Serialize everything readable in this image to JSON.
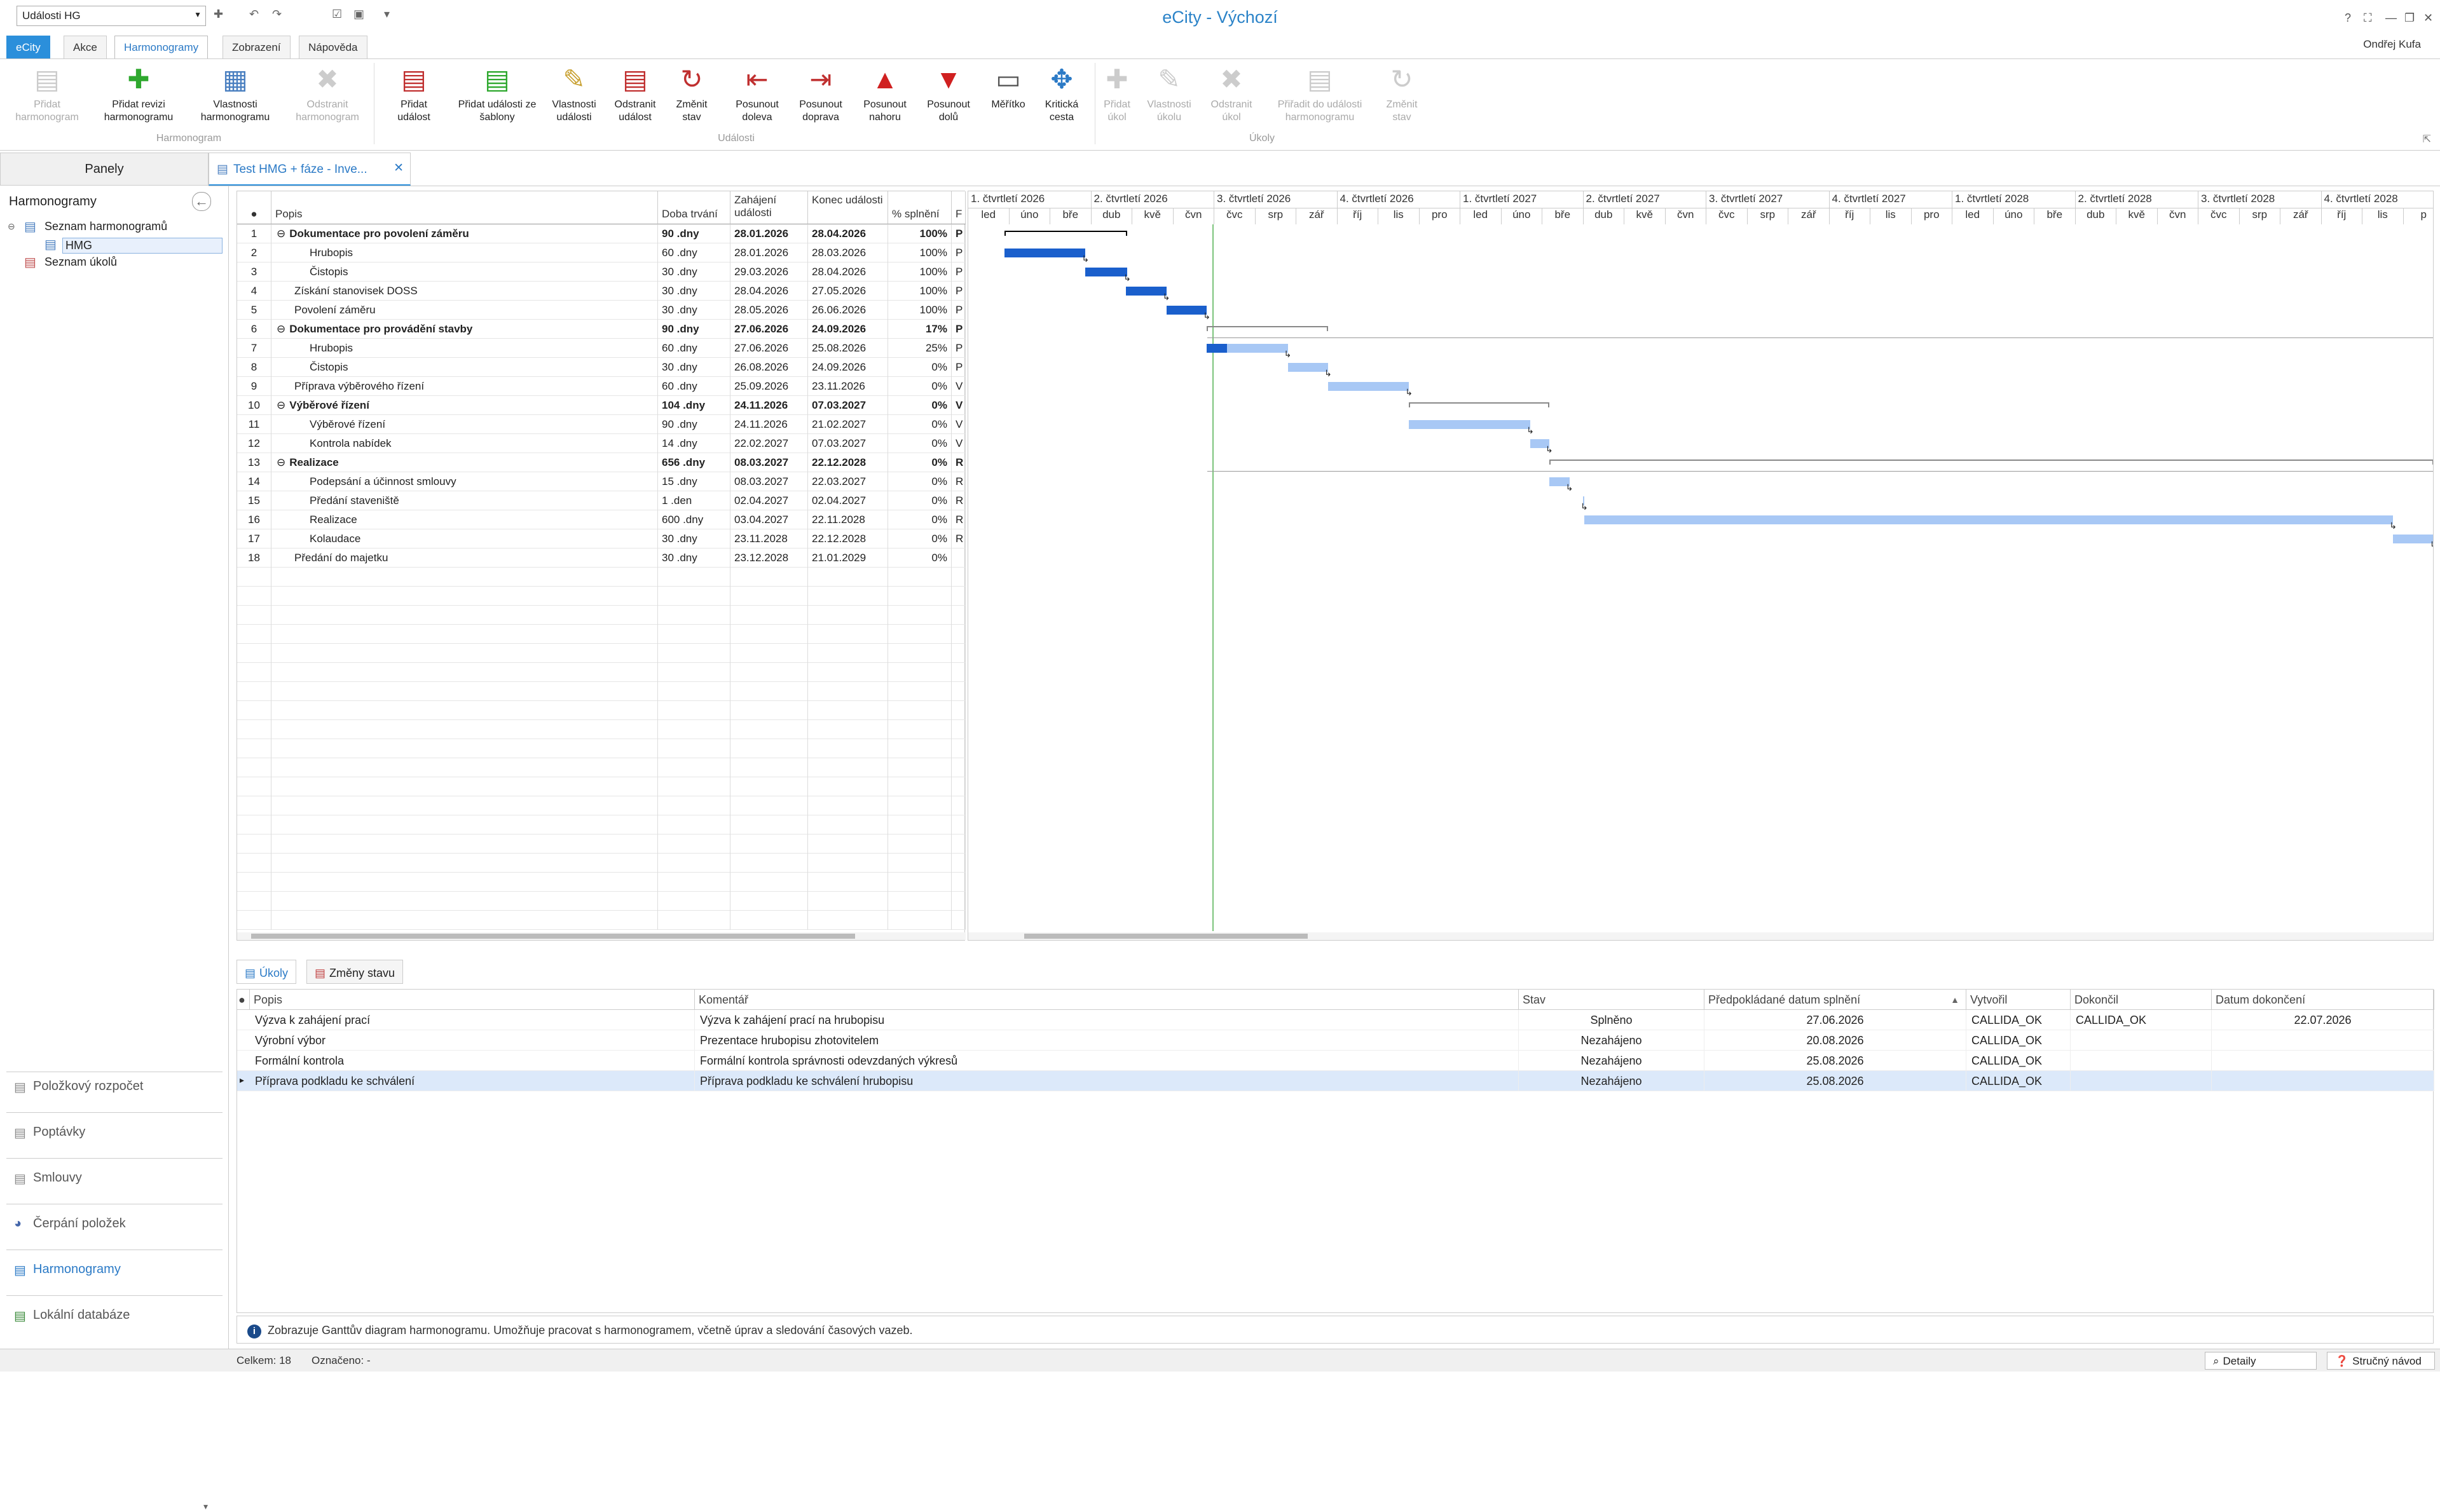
{
  "app": {
    "title": "eCity - Výchozí",
    "context_select": "Události HG",
    "user": "Ondřej Kufa"
  },
  "tabs": [
    "eCity",
    "Akce",
    "Harmonogramy",
    "Zobrazení",
    "Nápověda"
  ],
  "ribbon": {
    "harmonogram_group": "Harmonogram",
    "udalosti_group": "Události",
    "ukoly_group": "Úkoly",
    "btn_pridat_harm": "Přidat harmonogram",
    "btn_pridat_revizi": "Přidat revizi harmonogramu",
    "btn_vlastnosti_harm": "Vlastnosti harmonogramu",
    "btn_odstranit_harm": "Odstranit harmonogram",
    "btn_pridat_udalost": "Přidat událost",
    "btn_pridat_ze_sablony": "Přidat události ze šablony",
    "btn_vlastnosti_udalosti": "Vlastnosti události",
    "btn_odstranit_udalost": "Odstranit událost",
    "btn_zmenit_stav": "Změnit stav",
    "btn_posunout_doleva": "Posunout doleva",
    "btn_posunout_doprava": "Posunout doprava",
    "btn_posunout_nahoru": "Posunout nahoru",
    "btn_posunout_dolu": "Posunout dolů",
    "btn_meritko": "Měřítko",
    "btn_kriticka_cesta": "Kritická cesta",
    "btn_pridat_ukol": "Přidat úkol",
    "btn_vlastnosti_ukolu": "Vlastnosti úkolu",
    "btn_odstranit_ukol": "Odstranit úkol",
    "btn_priradit": "Přiřadit do události harmonogramu",
    "btn_zmenit_stav_ukol": "Změnit stav"
  },
  "left": {
    "panels_title": "Panely",
    "section": "Harmonogramy",
    "tree": [
      "Seznam harmonogramů",
      "HMG",
      "Seznam úkolů"
    ],
    "nav": [
      "Položkový rozpočet",
      "Poptávky",
      "Smlouvy",
      "Čerpání položek",
      "Harmonogramy",
      "Lokální databáze"
    ]
  },
  "doc_tab": "Test HMG + fáze - Inve...",
  "grid": {
    "headers": {
      "id": "",
      "popis": "Popis",
      "doba": "Doba trvání",
      "zahajeni": "Zahájení události",
      "konec": "Konec události",
      "splneni": "% splnění",
      "f": "F"
    },
    "rows": [
      {
        "n": "1",
        "popis": "Dokumentace pro povolení záměru",
        "doba": "90 .dny",
        "zah": "28.01.2026",
        "kon": "28.04.2026",
        "pct": "100%",
        "f": "P",
        "bold": true,
        "group": true
      },
      {
        "n": "2",
        "popis": "Hrubopis",
        "doba": "60 .dny",
        "zah": "28.01.2026",
        "kon": "28.03.2026",
        "pct": "100%",
        "f": "P",
        "level": 2
      },
      {
        "n": "3",
        "popis": "Čistopis",
        "doba": "30 .dny",
        "zah": "29.03.2026",
        "kon": "28.04.2026",
        "pct": "100%",
        "f": "P",
        "level": 2
      },
      {
        "n": "4",
        "popis": "Získání stanovisek DOSS",
        "doba": "30 .dny",
        "zah": "28.04.2026",
        "kon": "27.05.2026",
        "pct": "100%",
        "f": "P",
        "level": 1
      },
      {
        "n": "5",
        "popis": "Povolení záměru",
        "doba": "30 .dny",
        "zah": "28.05.2026",
        "kon": "26.06.2026",
        "pct": "100%",
        "f": "P",
        "level": 1
      },
      {
        "n": "6",
        "popis": "Dokumentace pro provádění stavby",
        "doba": "90 .dny",
        "zah": "27.06.2026",
        "kon": "24.09.2026",
        "pct": "17%",
        "f": "P",
        "bold": true,
        "group": true
      },
      {
        "n": "7",
        "popis": "Hrubopis",
        "doba": "60 .dny",
        "zah": "27.06.2026",
        "kon": "25.08.2026",
        "pct": "25%",
        "f": "P",
        "level": 2
      },
      {
        "n": "8",
        "popis": "Čistopis",
        "doba": "30 .dny",
        "zah": "26.08.2026",
        "kon": "24.09.2026",
        "pct": "0%",
        "f": "P",
        "level": 2
      },
      {
        "n": "9",
        "popis": "Příprava výběrového řízení",
        "doba": "60 .dny",
        "zah": "25.09.2026",
        "kon": "23.11.2026",
        "pct": "0%",
        "f": "V",
        "level": 1
      },
      {
        "n": "10",
        "popis": "Výběrové řízení",
        "doba": "104 .dny",
        "zah": "24.11.2026",
        "kon": "07.03.2027",
        "pct": "0%",
        "f": "V",
        "bold": true,
        "group": true
      },
      {
        "n": "11",
        "popis": "Výběrové řízení",
        "doba": "90 .dny",
        "zah": "24.11.2026",
        "kon": "21.02.2027",
        "pct": "0%",
        "f": "V",
        "level": 2
      },
      {
        "n": "12",
        "popis": "Kontrola nabídek",
        "doba": "14 .dny",
        "zah": "22.02.2027",
        "kon": "07.03.2027",
        "pct": "0%",
        "f": "V",
        "level": 2
      },
      {
        "n": "13",
        "popis": "Realizace",
        "doba": "656 .dny",
        "zah": "08.03.2027",
        "kon": "22.12.2028",
        "pct": "0%",
        "f": "R",
        "bold": true,
        "group": true
      },
      {
        "n": "14",
        "popis": "Podepsání a účinnost smlouvy",
        "doba": "15 .dny",
        "zah": "08.03.2027",
        "kon": "22.03.2027",
        "pct": "0%",
        "f": "R",
        "level": 2
      },
      {
        "n": "15",
        "popis": "Předání staveniště",
        "doba": "1 .den",
        "zah": "02.04.2027",
        "kon": "02.04.2027",
        "pct": "0%",
        "f": "R",
        "level": 2
      },
      {
        "n": "16",
        "popis": "Realizace",
        "doba": "600 .dny",
        "zah": "03.04.2027",
        "kon": "22.11.2028",
        "pct": "0%",
        "f": "R",
        "level": 2
      },
      {
        "n": "17",
        "popis": "Kolaudace",
        "doba": "30 .dny",
        "zah": "23.11.2028",
        "kon": "22.12.2028",
        "pct": "0%",
        "f": "R",
        "level": 2
      },
      {
        "n": "18",
        "popis": "Předání do majetku",
        "doba": "30 .dny",
        "zah": "23.12.2028",
        "kon": "21.01.2029",
        "pct": "0%",
        "f": "",
        "level": 1
      }
    ]
  },
  "gantt": {
    "quarters": [
      "1. čtvrtletí 2026",
      "2. čtvrtletí 2026",
      "3. čtvrtletí 2026",
      "4. čtvrtletí 2026",
      "1. čtvrtletí 2027",
      "2. čtvrtletí 2027",
      "3. čtvrtletí 2027",
      "4. čtvrtletí 2027",
      "1. čtvrtletí 2028",
      "2. čtvrtletí 2028",
      "3. čtvrtletí 2028",
      "4. čtvrtletí 2028"
    ],
    "months": [
      "led",
      "úno",
      "bře",
      "dub",
      "kvě",
      "čvn",
      "čvc",
      "srp",
      "zář",
      "říj",
      "lis",
      "pro",
      "led",
      "úno",
      "bře",
      "dub",
      "kvě",
      "čvn",
      "čvc",
      "srp",
      "zář",
      "říj",
      "lis",
      "pro",
      "led",
      "úno",
      "bře",
      "dub",
      "kvě",
      "čvn",
      "čvc",
      "srp",
      "zář",
      "říj",
      "lis",
      "p"
    ]
  },
  "bottom_tabs": [
    "Úkoly",
    "Změny stavu"
  ],
  "tasks": {
    "headers": [
      "Popis",
      "Komentář",
      "Stav",
      "Předpokládané datum splnění",
      "Vytvořil",
      "Dokončil",
      "Datum dokončení"
    ],
    "rows": [
      [
        "Výzva k zahájení prací",
        "Výzva k zahájení prací na hrubopisu",
        "Splněno",
        "27.06.2026",
        "CALLIDA_OK",
        "CALLIDA_OK",
        "22.07.2026"
      ],
      [
        "Výrobní výbor",
        "Prezentace hrubopisu zhotovitelem",
        "Nezahájeno",
        "20.08.2026",
        "CALLIDA_OK",
        "",
        ""
      ],
      [
        "Formální kontrola",
        "Formální kontrola správnosti odevzdaných výkresů",
        "Nezahájeno",
        "25.08.2026",
        "CALLIDA_OK",
        "",
        ""
      ],
      [
        "Příprava podkladu ke schválení",
        "Příprava podkladu ke schválení hrubopisu",
        "Nezahájeno",
        "25.08.2026",
        "CALLIDA_OK",
        "",
        ""
      ]
    ]
  },
  "info": "Zobrazuje Ganttův diagram harmonogramu. Umožňuje pracovat s harmonogramem, včetně úprav a sledování časových vazeb.",
  "status": {
    "celkem": "Celkem: 18",
    "oznaceno": "Označeno: -",
    "detaily": "Detaily",
    "navod": "Stručný návod"
  }
}
